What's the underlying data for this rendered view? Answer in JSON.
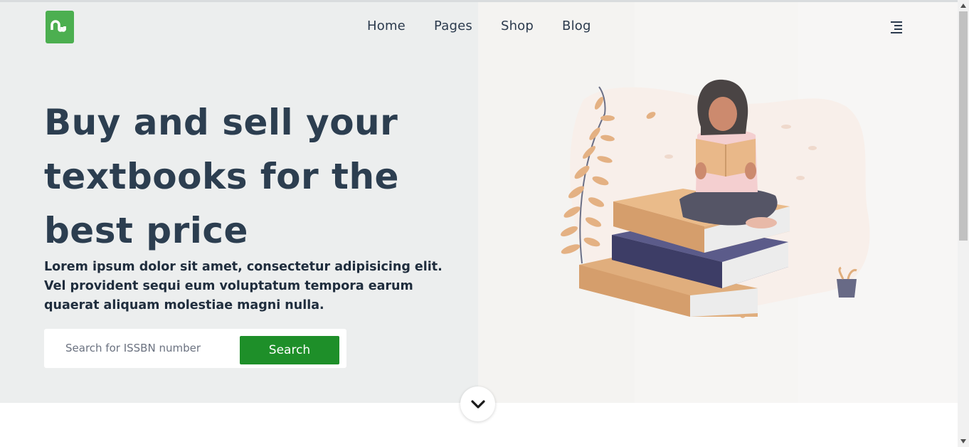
{
  "header": {
    "logo_icon": "stumbleupon-icon",
    "logo_color": "#4caf50",
    "nav": [
      {
        "label": "Home"
      },
      {
        "label": "Pages"
      },
      {
        "label": "Shop"
      },
      {
        "label": "Blog"
      }
    ],
    "menu_icon": "menu-icon"
  },
  "hero": {
    "title_lines": [
      "Buy and sell your",
      "textbooks for the",
      "best price"
    ],
    "description": "Lorem ipsum dolor sit amet, consectetur adipisicing elit. Vel provident sequi eum voluptatum tempora earum quaerat aliquam molestiae magni nulla.",
    "search": {
      "placeholder": "Search for ISSBN number",
      "value": "",
      "button_label": "Search",
      "button_color": "#1e8f29"
    },
    "illustration_icon": "woman-reading-on-books-illustration",
    "scroll_down_icon": "chevron-down-icon"
  },
  "colors": {
    "text_dark": "#2c3e50",
    "hero_bg": "#eceeee"
  }
}
